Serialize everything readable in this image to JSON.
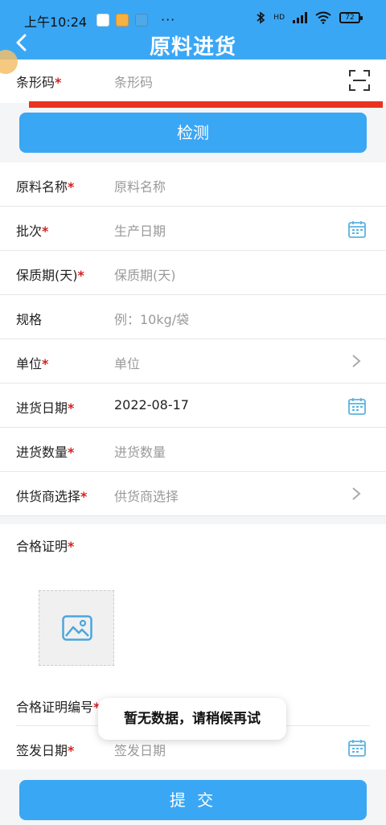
{
  "status_bar": {
    "time": "上午10:24",
    "more": "···",
    "network": "HD",
    "battery": "72"
  },
  "header": {
    "title": "原料进货"
  },
  "barcode": {
    "label": "条形码",
    "placeholder": "条形码"
  },
  "detect_button": "检测",
  "form": {
    "rows": [
      {
        "label": "原料名称",
        "required": "*",
        "value": "原料名称"
      },
      {
        "label": "批次",
        "required": "*",
        "value": "生产日期"
      },
      {
        "label": "保质期(天)",
        "required": "*",
        "value": "保质期(天)"
      },
      {
        "label": "规格",
        "required": "",
        "value": "例：10kg/袋"
      },
      {
        "label": "单位",
        "required": "*",
        "value": "单位"
      },
      {
        "label": "进货日期",
        "required": "*",
        "value": "2022-08-17"
      },
      {
        "label": "进货数量",
        "required": "*",
        "value": "进货数量"
      },
      {
        "label": "供货商选择",
        "required": "*",
        "value": "供货商选择"
      }
    ]
  },
  "certificate": {
    "label": "合格证明",
    "required": "*",
    "number_label": "合格证明编号",
    "number_required": "*",
    "sign_date_label": "签发日期",
    "sign_date_required": "*",
    "sign_date_placeholder": "签发日期"
  },
  "toast": "暂无数据，请稍候再试",
  "submit_button": "提 交",
  "colors": {
    "primary": "#3aa7f5",
    "required": "#d81e1e",
    "highlight_line": "#e8331f"
  }
}
